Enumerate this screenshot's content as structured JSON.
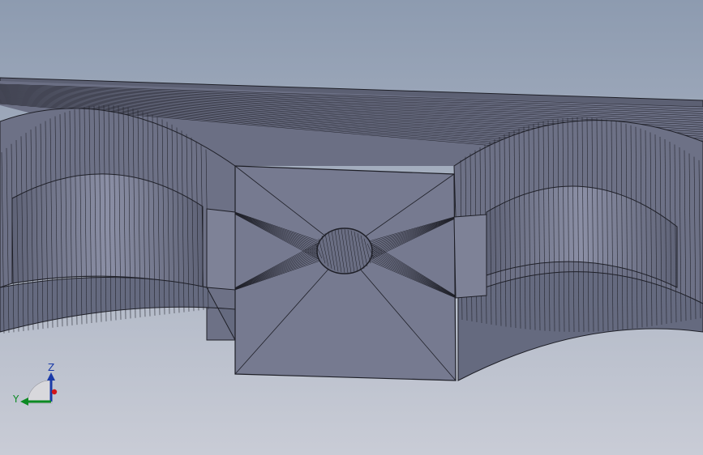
{
  "viewport": {
    "background_top": "#8d9bb0",
    "background_bottom": "#c9ccd6",
    "model_face_color": "#7b7f95",
    "edge_color": "#1e1f27"
  },
  "triad": {
    "z_label": "Z",
    "y_label": "Y",
    "z_color": "#1a3aa8",
    "y_color": "#0c8a23",
    "x_color": "#d4161b"
  }
}
